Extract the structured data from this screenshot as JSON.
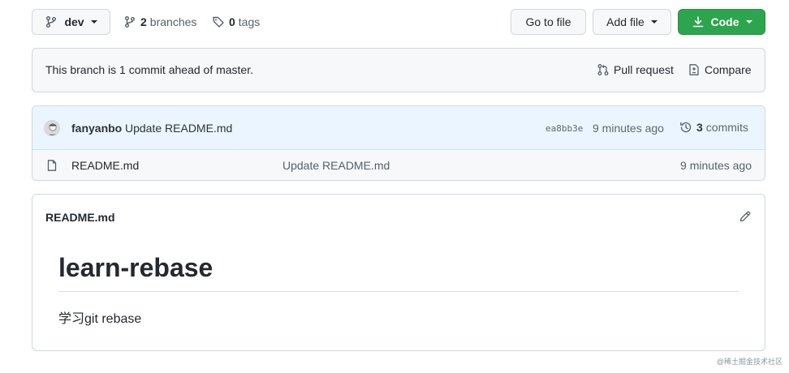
{
  "branch_select": {
    "label": "dev"
  },
  "branches": {
    "count": "2",
    "label": "branches"
  },
  "tags": {
    "count": "0",
    "label": "tags"
  },
  "buttons": {
    "go_to_file": "Go to file",
    "add_file": "Add file",
    "code": "Code"
  },
  "flash": {
    "message": "This branch is 1 commit ahead of master.",
    "pull_request": "Pull request",
    "compare": "Compare"
  },
  "latest_commit": {
    "author": "fanyanbo",
    "message": "Update README.md",
    "sha": "ea8bb3e",
    "time": "9 minutes ago",
    "commits_count": "3",
    "commits_label": "commits"
  },
  "files": [
    {
      "name": "README.md",
      "message": "Update README.md",
      "time": "9 minutes ago"
    }
  ],
  "readme": {
    "filename": "README.md",
    "heading": "learn-rebase",
    "body": "学习git rebase"
  },
  "watermark": "@稀土掘金技术社区",
  "colors": {
    "accent_green": "#2da44e",
    "commit_row_bg": "#ddf4ff",
    "border": "#d0d7de"
  }
}
